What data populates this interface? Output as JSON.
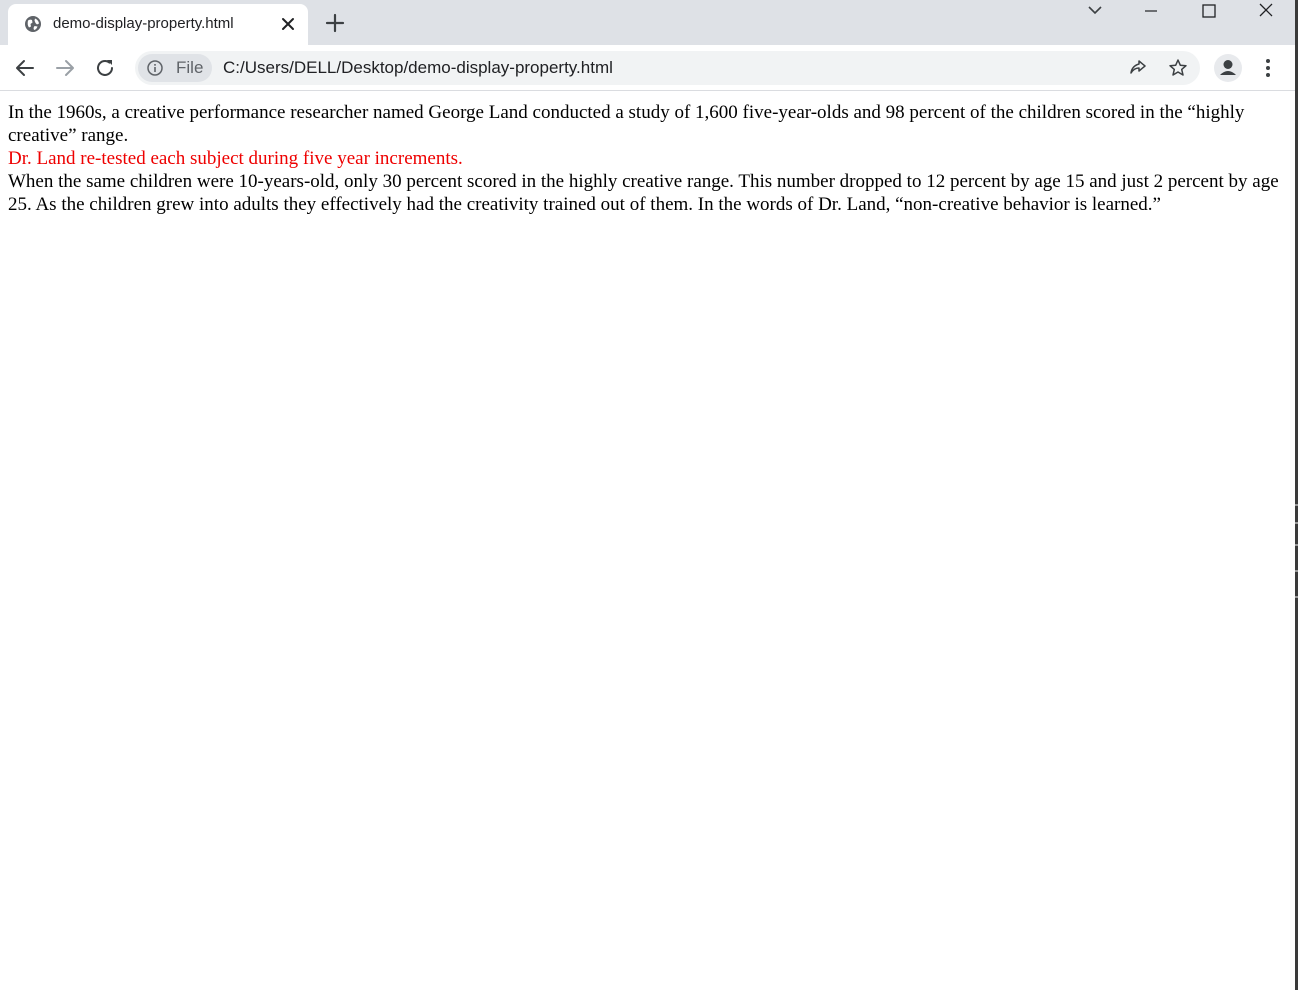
{
  "browser": {
    "tab": {
      "title": "demo-display-property.html"
    },
    "address_bar": {
      "security_chip_label": "File",
      "url": "C:/Users/DELL/Desktop/demo-display-property.html"
    },
    "icons": {
      "favicon": "globe-icon",
      "tab_close": "close-icon",
      "new_tab": "plus-icon",
      "tab_search": "chevron-down-icon",
      "minimize": "minimize-icon",
      "maximize": "maximize-icon",
      "close_window": "close-window-icon",
      "back": "arrow-left-icon",
      "forward": "arrow-right-icon",
      "reload": "reload-icon",
      "site_info": "info-icon",
      "share": "share-icon",
      "bookmark": "star-icon",
      "profile": "person-icon",
      "menu": "kebab-menu-icon"
    }
  },
  "page": {
    "paragraph_1": "In the 1960s, a creative performance researcher named George Land conducted a study of 1,600 five-year-olds and 98 percent of the children scored in the “highly creative” range.",
    "paragraph_2": "Dr. Land re-tested each subject during five year increments.",
    "paragraph_3": "When the same children were 10-years-old, only 30 percent scored in the highly creative range. This number dropped to 12 percent by age 15 and just 2 percent by age 25. As the children grew into adults they effectively had the creativity trained out of them. In the words of Dr. Land, “non-creative behavior is learned.”",
    "highlight_color": "#ee0000"
  }
}
